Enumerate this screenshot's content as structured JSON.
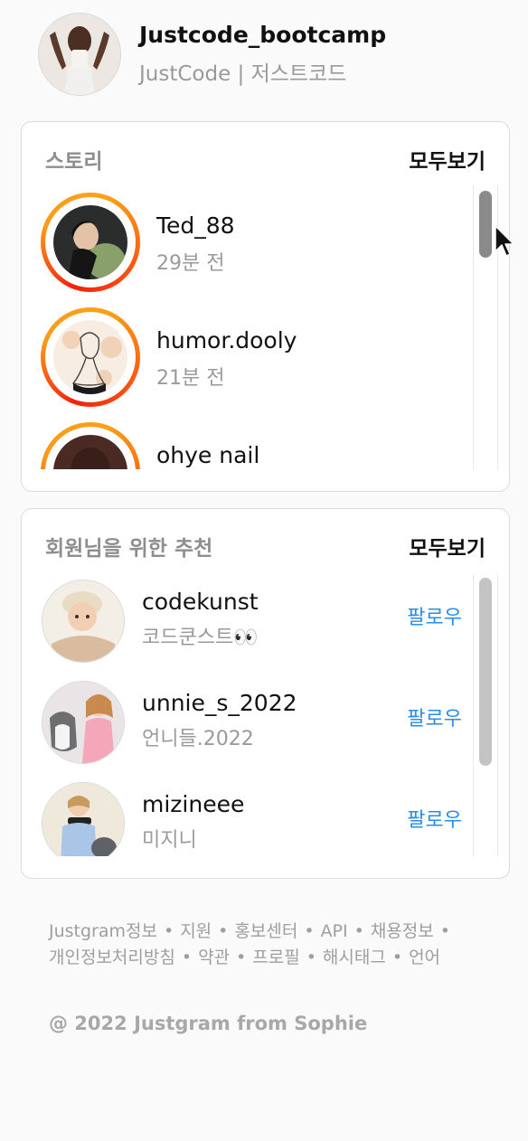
{
  "profile": {
    "username": "Justcode_bootcamp",
    "subtitle": "JustCode | 저스트코드"
  },
  "stories": {
    "title": "스토리",
    "see_all": "모두보기",
    "items": [
      {
        "name": "Ted_88",
        "time": "29분 전"
      },
      {
        "name": "humor.dooly",
        "time": "21분 전"
      },
      {
        "name": "ohye    nail",
        "time": ""
      }
    ]
  },
  "recommendations": {
    "title": "회원님을 위한 추천",
    "see_all": "모두보기",
    "items": [
      {
        "username": "codekunst",
        "subtitle": "코드쿤스트👀",
        "action": "팔로우"
      },
      {
        "username": "unnie_s_2022",
        "subtitle": "언니들.2022",
        "action": "팔로우"
      },
      {
        "username": "mizineee",
        "subtitle": "미지니",
        "action": "팔로우"
      }
    ]
  },
  "footer": {
    "links": [
      "Justgram정보",
      "지원",
      "홍보센터",
      "API",
      "채용정보",
      "개인정보처리방침",
      "약관",
      "프로필",
      "해시태그",
      "언어"
    ],
    "separator": "•",
    "copyright": "@ 2022 Justgram from Sophie"
  },
  "colors": {
    "accent_link": "#2a8ee8",
    "story_ring_start": "#f5200f",
    "story_ring_end": "#ff9a17"
  }
}
